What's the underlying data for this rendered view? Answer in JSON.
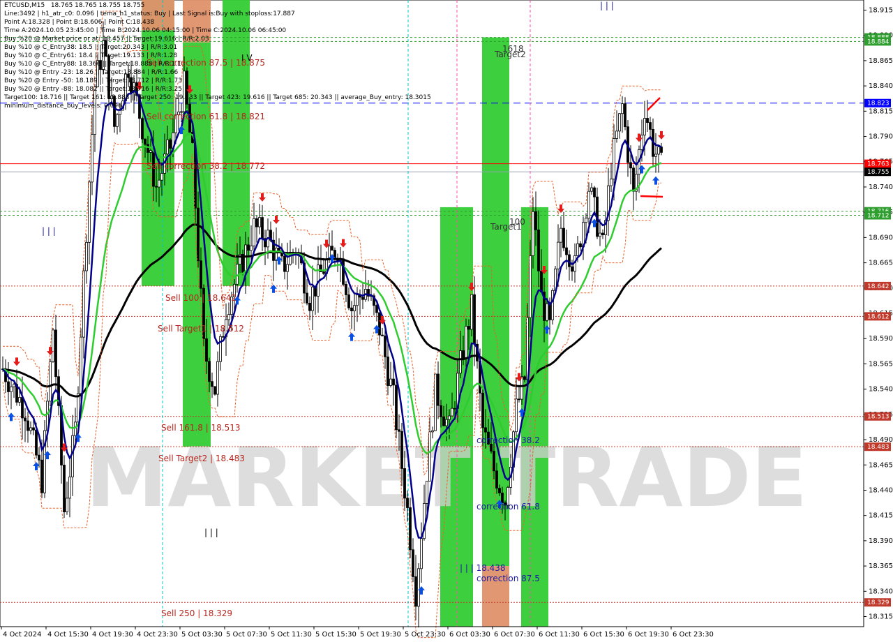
{
  "chart_data": {
    "type": "candlestick",
    "symbol_header": "ETCUSD,M15   18.765 18.765 18.755 18.755",
    "y_ticks": [
      "18.915",
      "18.890",
      "18.865",
      "18.840",
      "18.815",
      "18.790",
      "18.765",
      "18.740",
      "18.715",
      "18.690",
      "18.665",
      "18.640",
      "18.615",
      "18.590",
      "18.565",
      "18.540",
      "18.515",
      "18.490",
      "18.465",
      "18.440",
      "18.415",
      "18.390",
      "18.365",
      "18.340",
      "18.315"
    ],
    "x_ticks": [
      "4 Oct 2024",
      "4 Oct 15:30",
      "4 Oct 19:30",
      "4 Oct 23:30",
      "5 Oct 03:30",
      "5 Oct 07:30",
      "5 Oct 11:30",
      "5 Oct 15:30",
      "5 Oct 19:30",
      "5 Oct 23:30",
      "6 Oct 03:30",
      "6 Oct 07:30",
      "6 Oct 11:30",
      "6 Oct 15:30",
      "6 Oct 19:30",
      "6 Oct 23:30"
    ],
    "info_lines": [
      "Line:3492 | h1_atr_c0: 0.096 | tema_h1_status: Buy | Last Signal is:Buy with stoploss:17.887",
      "Point A:18.328 | Point B:18.606 | Point C:18.438",
      "Time A:2024.10.05 23:45:00 | Time B:2024.10.06 04:15:00 | Time C:2024.10.06 06:45:00",
      "Buy %20 @ Market price or at: 18.457 || Target:19.616 | R/R:2.03",
      "Buy %10 @ C_Entry38: 18.5 || Target:20.343 | R/R:3.01",
      "Buy %10 @ C_Entry61: 18.4 || Target:19.133 | R/R:1.28",
      "Buy %10 @ C_Entry88: 18.366 || Target:18.888 | R/R:1.1",
      "Buy %10 @ Entry -23: 18.26 || Target:18.884 | R/R:1.66",
      "Buy %20 @ Entry -50: 18.189 || Target:18.712 | R/R:1.73",
      "Buy %20 @ Entry -88: 18.082 || Target:18.716 | R/R:3.25",
      "Target100: 18.716 || Target 161: 18.888 || Target 250: 19.133 || Target 423: 19.616 || Target 685: 20.343 || average_Buy_entry: 18.3015",
      "minimum_distance_buy_levels: 0.096"
    ],
    "price_tags": [
      {
        "label": "18.888",
        "color": "#2e9e2e"
      },
      {
        "label": "18.884",
        "color": "#2e9e2e"
      },
      {
        "label": "18.823",
        "color": "#0000ff"
      },
      {
        "label": "18.763",
        "color": "#ff0000"
      },
      {
        "label": "18.755",
        "color": "#000000"
      },
      {
        "label": "18.716",
        "color": "#2e9e2e"
      },
      {
        "label": "18.712",
        "color": "#2e9e2e"
      },
      {
        "label": "18.642",
        "color": "#c0392b"
      },
      {
        "label": "18.612",
        "color": "#c0392b"
      },
      {
        "label": "18.513",
        "color": "#c0392b"
      },
      {
        "label": "18.483",
        "color": "#c0392b"
      },
      {
        "label": "18.329",
        "color": "#c0392b"
      }
    ],
    "level_labels": [
      {
        "text": "Sell correction 87.5 | 18.875",
        "color": "#b5261e"
      },
      {
        "text": "Sell correction 61.8 | 18.821",
        "color": "#b5261e"
      },
      {
        "text": "Sell correction 38.2 | 18.772",
        "color": "#b5261e"
      },
      {
        "text": "Sell 100 | 18.642",
        "color": "#b5261e"
      },
      {
        "text": "Sell Target1 | 18.612",
        "color": "#b5261e"
      },
      {
        "text": "Sell 161.8 | 18.513",
        "color": "#b5261e"
      },
      {
        "text": "Sell Target2 | 18.483",
        "color": "#b5261e"
      },
      {
        "text": "Sell 250 | 18.329",
        "color": "#b5261e"
      },
      {
        "text": "Target2",
        "color": "#333333"
      },
      {
        "text": "Target1",
        "color": "#333333"
      },
      {
        "text": "correction 38.2",
        "color": "#1a1aa6"
      },
      {
        "text": "correction 61.8",
        "color": "#1a1aa6"
      },
      {
        "text": "correction 87.5",
        "color": "#1a1aa6"
      },
      {
        "text": "| | | 18.438",
        "color": "#1a1aa6"
      },
      {
        "text": "I V",
        "color": "#000000"
      },
      {
        "text": "| | |",
        "color": "#1a1aa6"
      },
      {
        "text": "| | |",
        "color": "#000000"
      },
      {
        "text": "| | |",
        "color": "#1a1aa6"
      },
      {
        "text": "1618",
        "color": "#333333"
      },
      {
        "text": "100",
        "color": "#333333"
      }
    ],
    "watermark": "MARKET TRADE",
    "colors": {
      "bull": "#000000",
      "bear": "#000000",
      "ema_fast": "#00008b",
      "ema_mid": "#2ecc2e",
      "ema_slow": "#000000",
      "zone_green": "#33cc33",
      "zone_orange": "#e0916b",
      "grid": "#ffffff"
    }
  }
}
